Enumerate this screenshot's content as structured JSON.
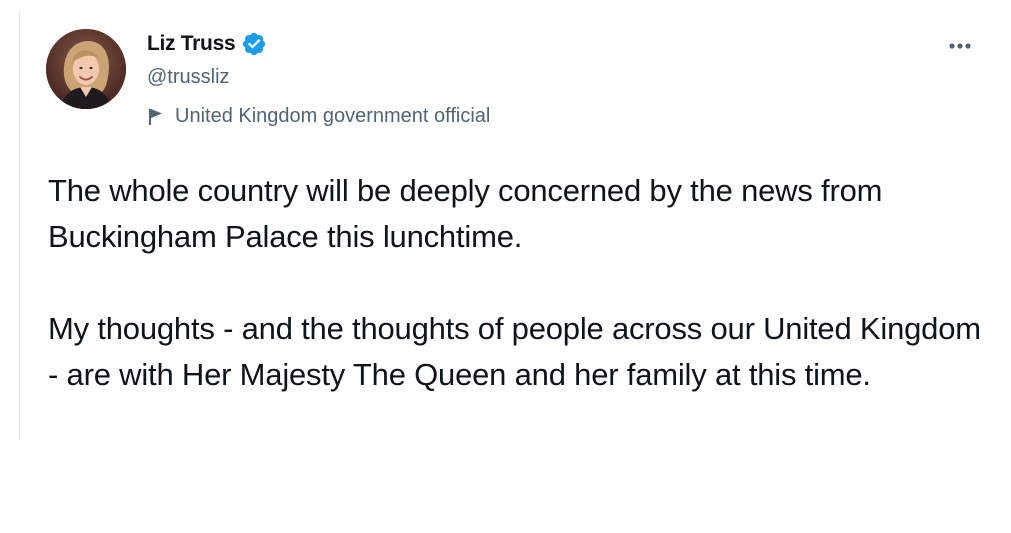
{
  "author": {
    "display_name": "Liz Truss",
    "handle": "@trussliz",
    "verified": true,
    "avatar_icon": "user-avatar-photo"
  },
  "label": {
    "icon": "flag-icon",
    "text": "United Kingdom government official"
  },
  "more_menu": {
    "icon": "ellipsis-icon"
  },
  "tweet": {
    "paragraphs": [
      "The whole country will be deeply concerned by the news from Buckingham Palace this lunchtime.",
      "My thoughts - and the thoughts of people across our United Kingdom - are with Her Majesty The Queen and her family at this time."
    ]
  },
  "colors": {
    "verified_blue": "#1d9bf0",
    "secondary_text": "#536471",
    "primary_text": "#0f1419"
  }
}
